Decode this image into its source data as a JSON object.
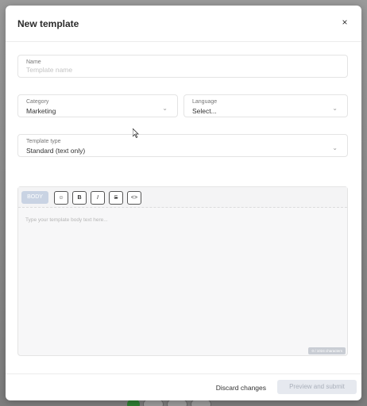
{
  "modal": {
    "title": "New template",
    "close_label": "×"
  },
  "form": {
    "name": {
      "label": "Name",
      "placeholder": "Template name",
      "value": ""
    },
    "category": {
      "label": "Category",
      "value": "Marketing"
    },
    "language": {
      "label": "Language",
      "value": "Select..."
    },
    "template_type": {
      "label": "Template type",
      "value": "Standard (text only)"
    }
  },
  "editor": {
    "section_label": "BODY",
    "toolbar": {
      "emoji_glyph": "☺",
      "bold_glyph": "B",
      "italic_glyph": "I",
      "strike_glyph": "S",
      "code_glyph": "<>"
    },
    "placeholder": "Type your template body text here...",
    "char_counter": "0 / 1024 characters"
  },
  "footer": {
    "discard_label": "Discard changes",
    "submit_label": "Preview and submit"
  },
  "colors": {
    "submit_bg": "#e6e9ef",
    "body_tag_bg": "#c9d3e3"
  }
}
